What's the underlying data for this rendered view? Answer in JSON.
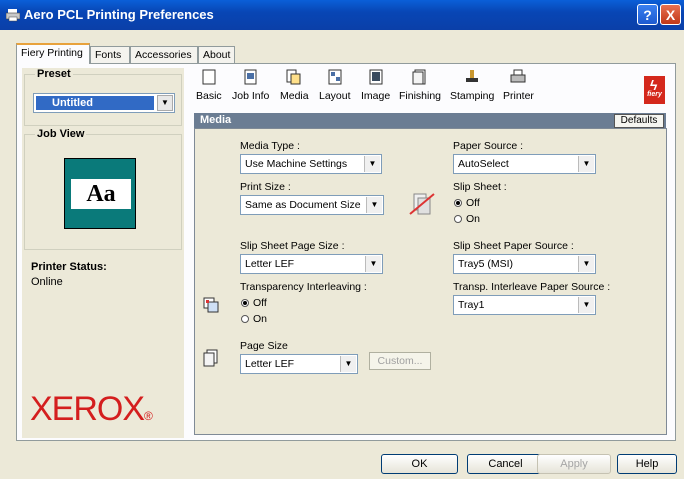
{
  "window": {
    "title": "Aero PCL Printing Preferences",
    "help_glyph": "?",
    "close_glyph": "X"
  },
  "tabs": [
    {
      "label": "Fiery Printing",
      "active": true
    },
    {
      "label": "Fonts",
      "active": false
    },
    {
      "label": "Accessories",
      "active": false
    },
    {
      "label": "About",
      "active": false
    }
  ],
  "left": {
    "preset_label": "Preset",
    "preset_value": "Untitled",
    "job_view_label": "Job View",
    "job_view_sample": "Aa",
    "printer_status_label": "Printer Status:",
    "printer_status_value": "Online",
    "brand": "XEROX"
  },
  "toolbar": {
    "items": [
      {
        "label": "Basic",
        "icon": "basic-icon"
      },
      {
        "label": "Job Info",
        "icon": "job-info-icon"
      },
      {
        "label": "Media",
        "icon": "media-icon"
      },
      {
        "label": "Layout",
        "icon": "layout-icon"
      },
      {
        "label": "Image",
        "icon": "image-icon"
      },
      {
        "label": "Finishing",
        "icon": "finishing-icon"
      },
      {
        "label": "Stamping",
        "icon": "stamping-icon"
      },
      {
        "label": "Printer",
        "icon": "printer-icon"
      }
    ],
    "logo_text": "fiery"
  },
  "section": {
    "title": "Media",
    "defaults_label": "Defaults"
  },
  "media": {
    "media_type_label": "Media Type :",
    "media_type_value": "Use Machine Settings",
    "print_size_label": "Print Size :",
    "print_size_value": "Same as Document Size",
    "slip_sheet_page_size_label": "Slip Sheet Page Size :",
    "slip_sheet_page_size_value": "Letter LEF",
    "transparency_label": "Transparency Interleaving :",
    "transparency_off": "Off",
    "transparency_on": "On",
    "page_size_label": "Page Size",
    "page_size_value": "Letter LEF",
    "custom_label": "Custom...",
    "paper_source_label": "Paper Source :",
    "paper_source_value": "AutoSelect",
    "slip_sheet_label": "Slip Sheet :",
    "slip_sheet_off": "Off",
    "slip_sheet_on": "On",
    "slip_sheet_paper_source_label": "Slip Sheet Paper Source :",
    "slip_sheet_paper_source_value": "Tray5 (MSI)",
    "transp_interleave_source_label": "Transp. Interleave Paper Source :",
    "transp_interleave_source_value": "Tray1"
  },
  "buttons": {
    "ok": "OK",
    "cancel": "Cancel",
    "apply": "Apply",
    "help": "Help"
  }
}
